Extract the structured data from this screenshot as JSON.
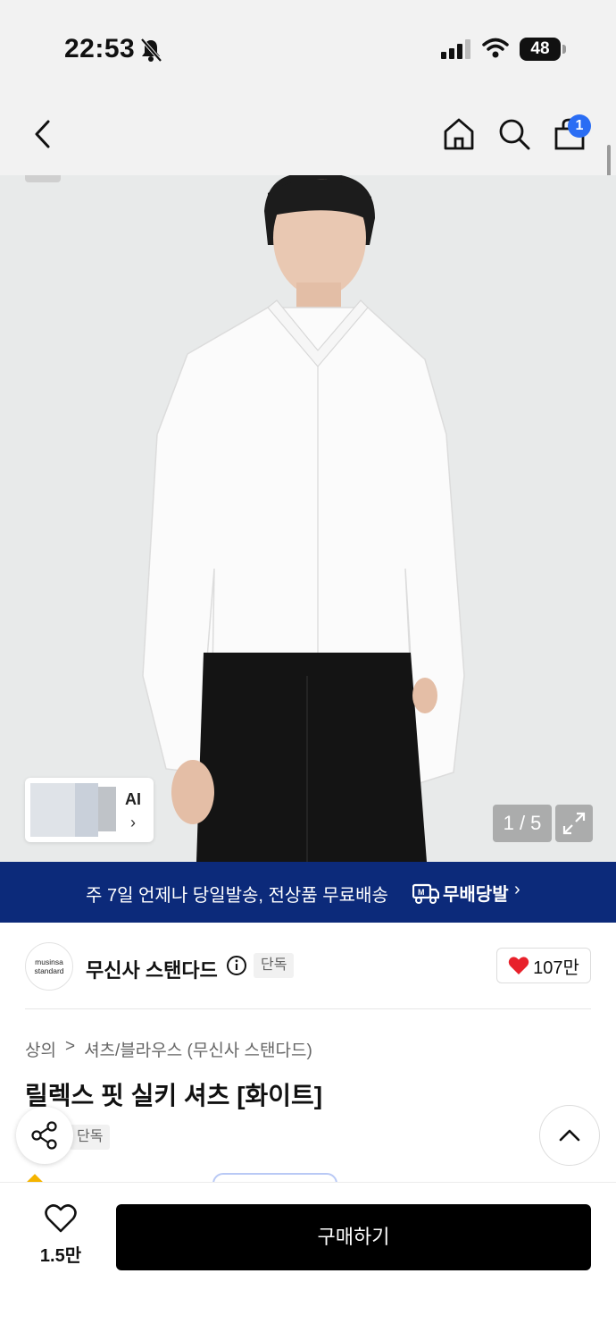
{
  "status_bar": {
    "time": "22:53",
    "battery": "48",
    "icons": [
      "bell-slash-icon",
      "signal-icon",
      "wifi-icon",
      "battery-icon"
    ]
  },
  "nav": {
    "cart_count": "1",
    "icons": [
      "chevron-left-icon",
      "home-icon",
      "search-icon",
      "shopping-bag-icon"
    ]
  },
  "gallery": {
    "ai_label": "AI",
    "ai_chevron": "›",
    "page_indicator": "1 / 5"
  },
  "banner": {
    "text": "주 7일 언제나 당일발송, 전상품 무료배송",
    "logo_text": "무배당발",
    "chevron": "›"
  },
  "brand": {
    "logo_line1": "musinsa",
    "logo_line2": "standard",
    "name": "무신사 스탠다드",
    "badge": "단독",
    "likes": "107만"
  },
  "product": {
    "breadcrumb": [
      "상의",
      ">",
      "셔츠/블라우스 (무신사 스탠다드)"
    ],
    "title": "릴렉스 핏 실키 셔츠 [화이트]",
    "badge": "단독"
  },
  "bottom_bar": {
    "wish_count": "1.5만",
    "buy_label": "구매하기"
  },
  "colors": {
    "banner_bg": "#0c2a7a",
    "badge_blue": "#2a6df4",
    "heart_red": "#e8212b",
    "buy_bg": "#000000"
  }
}
